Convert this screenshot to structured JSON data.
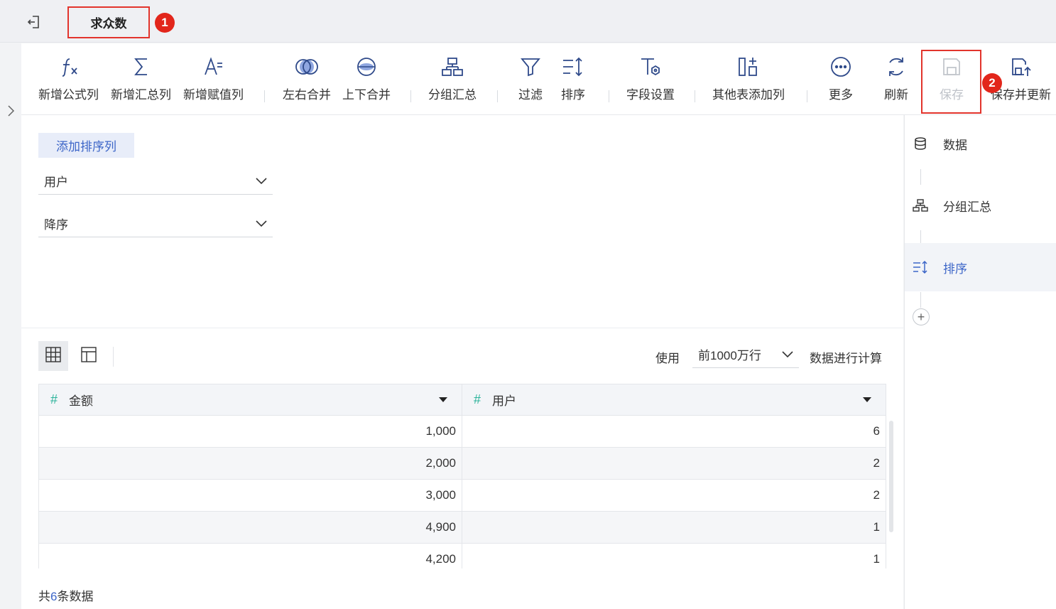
{
  "header": {
    "title": "求众数",
    "badge1": "1",
    "badge2": "2"
  },
  "toolbar": {
    "items": [
      {
        "label": "新增公式列",
        "icon": "formula-icon"
      },
      {
        "label": "新增汇总列",
        "icon": "sigma-icon"
      },
      {
        "label": "新增赋值列",
        "icon": "assign-icon"
      },
      {
        "label": "左右合并",
        "icon": "join-icon"
      },
      {
        "label": "上下合并",
        "icon": "union-icon"
      },
      {
        "label": "分组汇总",
        "icon": "group-icon"
      },
      {
        "label": "过滤",
        "icon": "filter-icon"
      },
      {
        "label": "排序",
        "icon": "sort-icon"
      },
      {
        "label": "字段设置",
        "icon": "field-settings-icon"
      },
      {
        "label": "其他表添加列",
        "icon": "add-column-icon"
      },
      {
        "label": "更多",
        "icon": "more-icon"
      },
      {
        "label": "刷新",
        "icon": "refresh-icon"
      },
      {
        "label": "保存",
        "icon": "save-icon",
        "disabled": true
      },
      {
        "label": "保存并更新",
        "icon": "save-update-icon"
      }
    ]
  },
  "sort_config": {
    "add_button": "添加排序列",
    "column_select": "用户",
    "order_select": "降序"
  },
  "preview": {
    "use_label": "使用",
    "rows_select": "前1000万行",
    "calc_label": "数据进行计算",
    "columns": [
      "金额",
      "用户"
    ],
    "rows": [
      [
        "1,000",
        "6"
      ],
      [
        "2,000",
        "2"
      ],
      [
        "3,000",
        "2"
      ],
      [
        "4,900",
        "1"
      ],
      [
        "4,200",
        "1"
      ]
    ],
    "footer_prefix": "共",
    "footer_count": "6",
    "footer_suffix": "条数据"
  },
  "steps": [
    {
      "label": "数据",
      "icon": "database-icon"
    },
    {
      "label": "分组汇总",
      "icon": "group-icon"
    },
    {
      "label": "排序",
      "icon": "sort-icon",
      "active": true
    }
  ],
  "colors": {
    "accent": "#3d66c8",
    "highlight_border": "#e2342c",
    "badge": "#e2261b",
    "hash_icon": "#2bb39a"
  }
}
